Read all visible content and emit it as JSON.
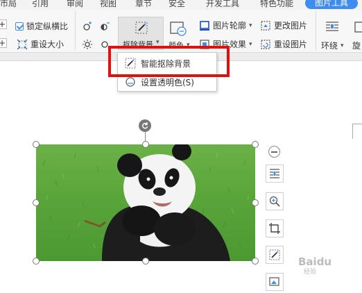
{
  "tabs": [
    {
      "label": "市局",
      "active": false
    },
    {
      "label": "引用",
      "active": false
    },
    {
      "label": "审阅",
      "active": false
    },
    {
      "label": "视图",
      "active": false
    },
    {
      "label": "章节",
      "active": false
    },
    {
      "label": "安全",
      "active": false
    },
    {
      "label": "开发工具",
      "active": false
    },
    {
      "label": "特色功能",
      "active": false
    },
    {
      "label": "图片工具",
      "active": true
    }
  ],
  "ribbon": {
    "lock_ratio": "锁定纵横比",
    "reset_size": "重设大小",
    "remove_bg": "抠除背景",
    "color": "颜色",
    "picture_outline": "图片轮廓",
    "picture_effect": "图片效果",
    "change_picture": "更改图片",
    "reset_picture": "重设图片",
    "wrap": "环绕",
    "rotate": "旋"
  },
  "dropdown": {
    "items": [
      {
        "label": "智能抠除背景"
      },
      {
        "label": "设置透明色(S)"
      }
    ]
  },
  "watermark": {
    "brand": "Baidu",
    "suffix": "经验"
  },
  "colors": {
    "accent": "#3f8cf0",
    "highlight": "#e20f0f"
  }
}
